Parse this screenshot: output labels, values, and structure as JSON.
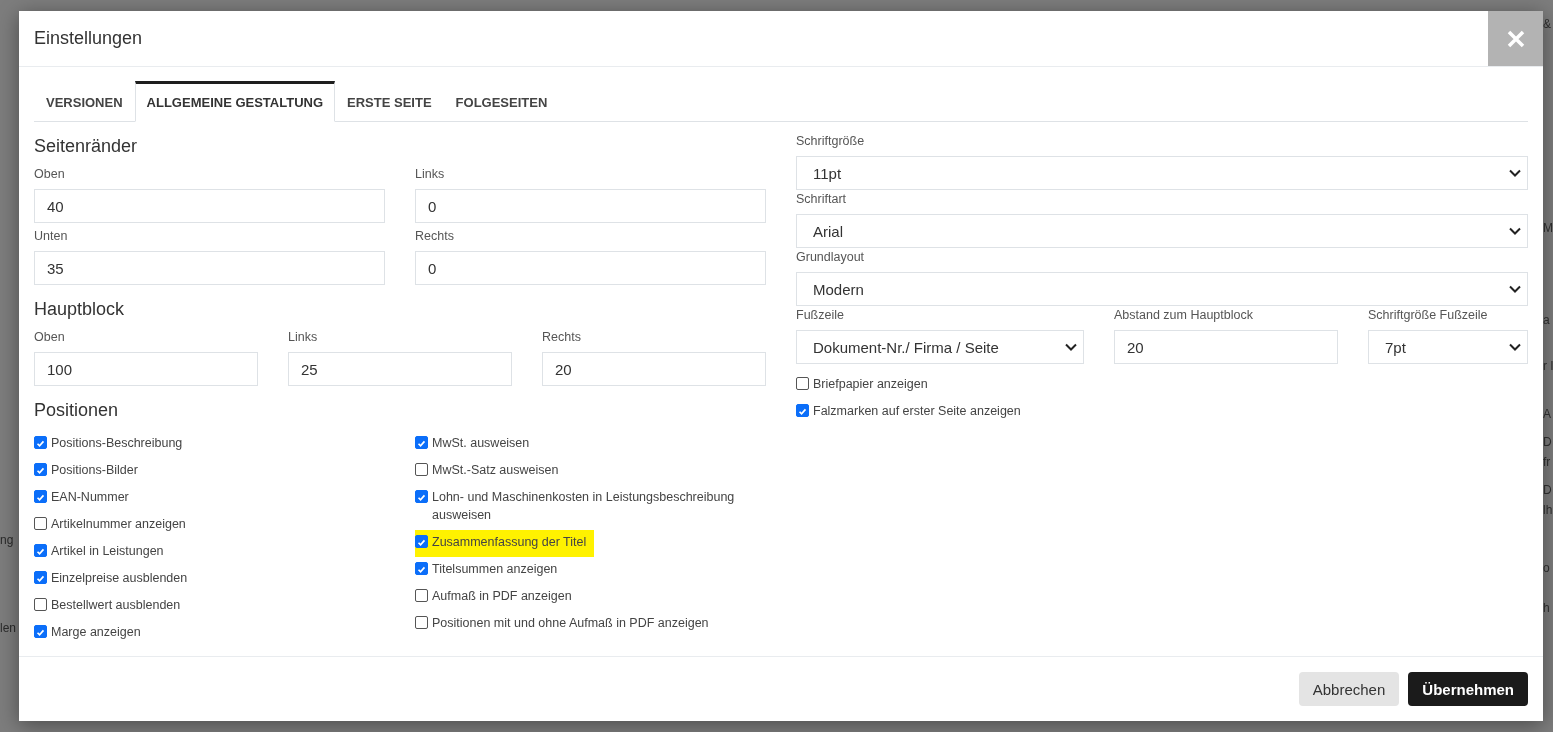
{
  "background": {
    "left": [
      "ng",
      "len"
    ],
    "right": [
      "&",
      "M",
      "a",
      "r I",
      "A",
      "D",
      "fr",
      "D",
      "lh",
      "o",
      "h"
    ]
  },
  "window": {
    "title": "Einstellungen"
  },
  "tabs": [
    {
      "label": "VERSIONEN",
      "selected": false
    },
    {
      "label": "ALLGEMEINE GESTALTUNG",
      "selected": true
    },
    {
      "label": "ERSTE SEITE",
      "selected": false
    },
    {
      "label": "FOLGESEITEN",
      "selected": false
    }
  ],
  "margins": {
    "title": "Seitenränder",
    "fields": [
      {
        "label": "Oben",
        "value": "40"
      },
      {
        "label": "Links",
        "value": "0"
      },
      {
        "label": "Unten",
        "value": "35"
      },
      {
        "label": "Rechts",
        "value": "0"
      }
    ]
  },
  "main_block": {
    "title": "Hauptblock",
    "fields": [
      {
        "label": "Oben",
        "value": "100"
      },
      {
        "label": "Links",
        "value": "25"
      },
      {
        "label": "Rechts",
        "value": "20"
      }
    ]
  },
  "positions": {
    "title": "Positionen",
    "columns": [
      [
        {
          "label": "Positions-Beschreibung",
          "checked": true,
          "highlighted": false
        },
        {
          "label": "Positions-Bilder",
          "checked": true,
          "highlighted": false
        },
        {
          "label": "EAN-Nummer",
          "checked": true,
          "highlighted": false
        },
        {
          "label": "Artikelnummer anzeigen",
          "checked": false,
          "highlighted": false
        },
        {
          "label": "Artikel in Leistungen",
          "checked": true,
          "highlighted": false
        },
        {
          "label": "Einzelpreise ausblenden",
          "checked": true,
          "highlighted": false
        },
        {
          "label": "Bestellwert ausblenden",
          "checked": false,
          "highlighted": false
        },
        {
          "label": "Marge anzeigen",
          "checked": true,
          "highlighted": false
        }
      ],
      [
        {
          "label": "MwSt. ausweisen",
          "checked": true,
          "highlighted": false
        },
        {
          "label": "MwSt.-Satz ausweisen",
          "checked": false,
          "highlighted": false
        },
        {
          "label": "Lohn- und Maschinenkosten in Leistungsbeschreibung ausweisen",
          "checked": true,
          "highlighted": false
        },
        {
          "label": "Zusammenfassung der Titel",
          "checked": true,
          "highlighted": true
        },
        {
          "label": "Titelsummen anzeigen",
          "checked": true,
          "highlighted": false
        },
        {
          "label": "Aufmaß in PDF anzeigen",
          "checked": false,
          "highlighted": false
        },
        {
          "label": "Positionen mit und ohne Aufmaß in PDF anzeigen",
          "checked": false,
          "highlighted": false
        }
      ]
    ]
  },
  "layout": {
    "fields": [
      {
        "kind": "select",
        "label": "Schriftgröße",
        "value": "11pt"
      },
      {
        "kind": "select",
        "label": "Schriftart",
        "value": "Arial"
      },
      {
        "kind": "select",
        "label": "Grundlayout",
        "value": "Modern"
      }
    ],
    "footer_row": [
      {
        "kind": "select",
        "label": "Fußzeile",
        "value": "Dokument-Nr./ Firma / Seite"
      },
      {
        "kind": "input",
        "label": "Abstand zum Hauptblock",
        "value": "20"
      },
      {
        "kind": "select",
        "label": "Schriftgröße Fußzeile",
        "value": "7pt"
      }
    ],
    "checkboxes": [
      {
        "label": "Briefpapier anzeigen",
        "checked": false,
        "highlighted": false
      },
      {
        "label": "Falzmarken auf erster Seite anzeigen",
        "checked": true,
        "highlighted": false
      }
    ]
  },
  "buttons": [
    {
      "label": "Abbrechen",
      "kind": "secondary"
    },
    {
      "label": "Übernehmen",
      "kind": "primary"
    }
  ]
}
